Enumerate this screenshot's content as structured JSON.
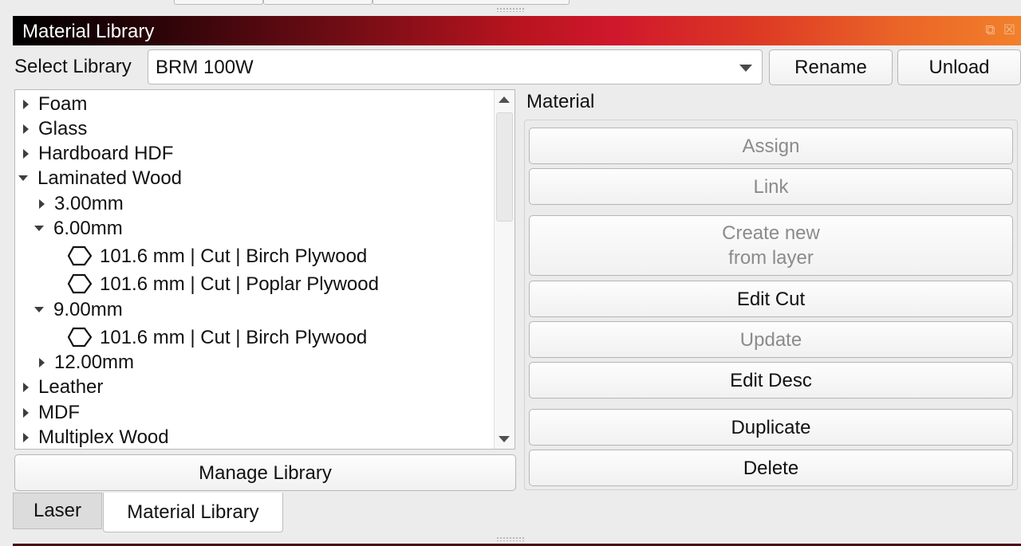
{
  "window": {
    "title": "Material Library",
    "float_icon": "float-icon",
    "close_icon": "close-icon"
  },
  "toolbar": {
    "select_label": "Select Library",
    "library_value": "BRM 100W",
    "rename_label": "Rename",
    "unload_label": "Unload"
  },
  "tree": {
    "items": [
      {
        "label": "Foam",
        "level": 0,
        "state": "collapsed"
      },
      {
        "label": "Glass",
        "level": 0,
        "state": "collapsed"
      },
      {
        "label": "Hardboard HDF",
        "level": 0,
        "state": "collapsed"
      },
      {
        "label": "Laminated Wood",
        "level": 0,
        "state": "expanded"
      },
      {
        "label": "3.00mm",
        "level": 1,
        "state": "collapsed"
      },
      {
        "label": "6.00mm",
        "level": 1,
        "state": "expanded"
      },
      {
        "label": "101.6 mm | Cut | Birch Plywood",
        "level": 2,
        "state": "leaf"
      },
      {
        "label": "101.6 mm | Cut | Poplar Plywood",
        "level": 2,
        "state": "leaf"
      },
      {
        "label": "9.00mm",
        "level": 1,
        "state": "expanded"
      },
      {
        "label": "101.6 mm | Cut | Birch Plywood",
        "level": 2,
        "state": "leaf"
      },
      {
        "label": "12.00mm",
        "level": 1,
        "state": "collapsed"
      },
      {
        "label": "Leather",
        "level": 0,
        "state": "collapsed"
      },
      {
        "label": "MDF",
        "level": 0,
        "state": "collapsed"
      },
      {
        "label": "Multiplex Wood",
        "level": 0,
        "state": "collapsed"
      }
    ],
    "manage_label": "Manage Library"
  },
  "material": {
    "label": "Material",
    "buttons": {
      "assign": "Assign",
      "link": "Link",
      "create_line1": "Create new",
      "create_line2": "from layer",
      "edit_cut": "Edit Cut",
      "update": "Update",
      "edit_desc": "Edit Desc",
      "duplicate": "Duplicate",
      "delete": "Delete"
    }
  },
  "tabs": [
    {
      "label": "Laser",
      "active": false
    },
    {
      "label": "Material Library",
      "active": true
    }
  ]
}
